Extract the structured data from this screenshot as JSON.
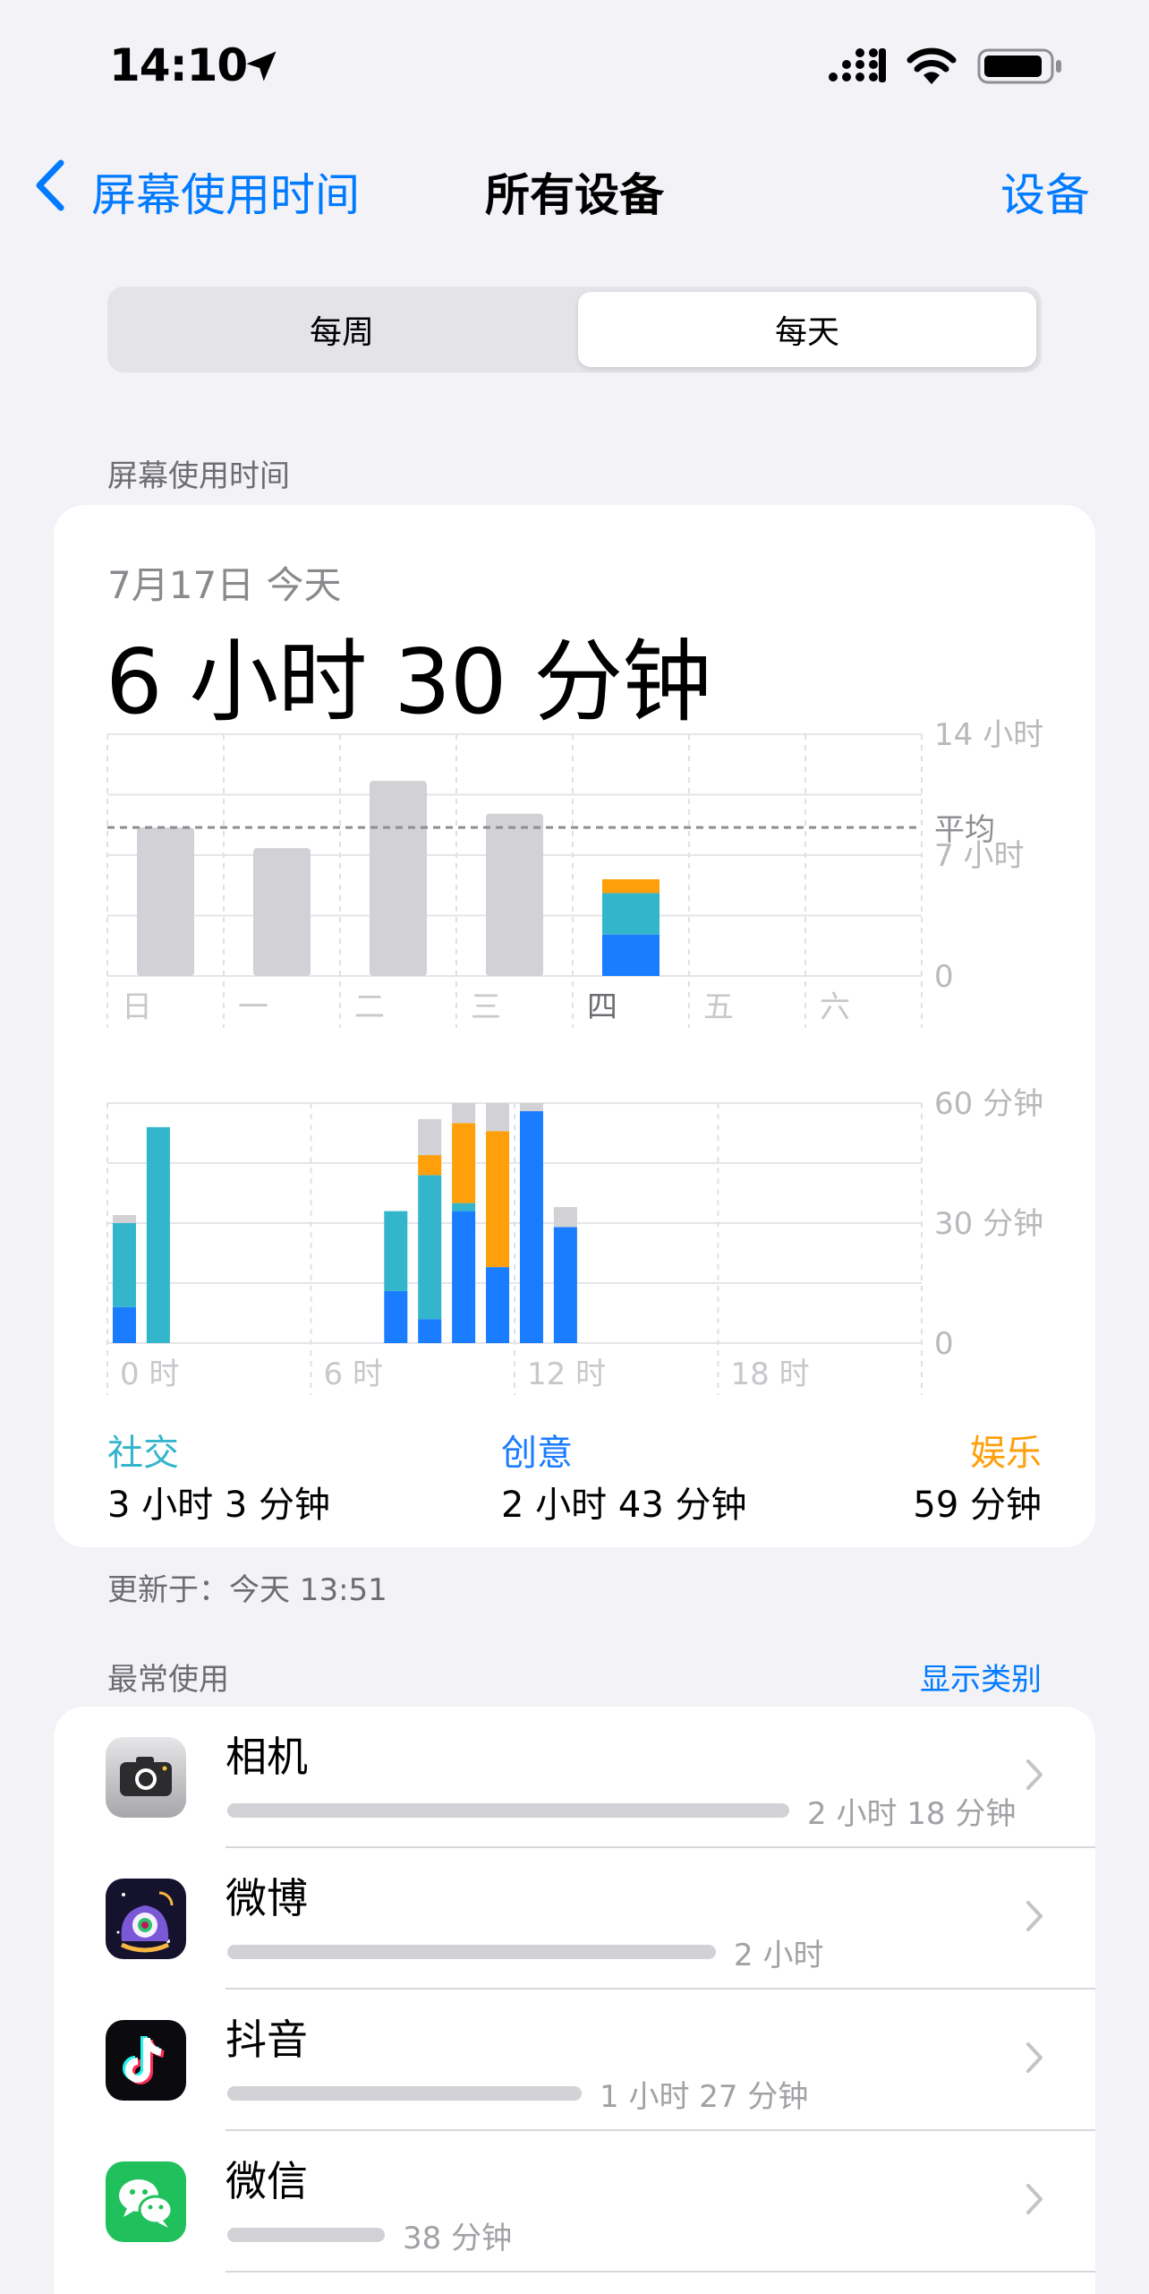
{
  "status_bar": {
    "time": "14:10"
  },
  "nav": {
    "back_label": "屏幕使用时间",
    "title": "所有设备",
    "right_label": "设备"
  },
  "segmented": {
    "weekly": "每周",
    "daily": "每天",
    "selected": "daily"
  },
  "section": {
    "screen_time_label": "屏幕使用时间",
    "most_used_label": "最常使用",
    "show_categories": "显示类别"
  },
  "summary": {
    "date": "7月17日 今天",
    "total": "6 小时 30 分钟",
    "updated": "更新于：今天 13:51"
  },
  "colors": {
    "social": "#33b5cc",
    "creativity": "#1a7cff",
    "entertainment": "#ff9f0a",
    "other": "#d1d1d6",
    "accent": "#007aff"
  },
  "chart_data": [
    {
      "type": "bar",
      "categories": [
        "日",
        "一",
        "二",
        "三",
        "四",
        "五",
        "六"
      ],
      "values": [
        8.6,
        7.4,
        11.3,
        9.4,
        5.6,
        0,
        0
      ],
      "series": [
        {
          "name": "社交",
          "values": [
            0,
            0,
            0,
            0,
            2.4
          ]
        },
        {
          "name": "创意",
          "values": [
            0,
            0,
            0,
            0,
            2.4
          ]
        },
        {
          "name": "娱乐",
          "values": [
            0,
            0,
            0,
            0,
            0.8
          ]
        }
      ],
      "ylim": [
        0,
        14
      ],
      "yticks": [
        {
          "value": 14,
          "label": "14 小时"
        },
        {
          "value": 7,
          "label": "7 小时"
        },
        {
          "value": 0,
          "label": "0"
        }
      ],
      "average": {
        "value": 8.6,
        "label": "平均"
      },
      "highlight_index": 4
    },
    {
      "type": "bar",
      "hours": [
        0,
        1,
        8,
        9,
        10,
        11,
        12,
        13
      ],
      "series": [
        {
          "name": "创意",
          "values": [
            9,
            0,
            13,
            6,
            33,
            19,
            58,
            29
          ]
        },
        {
          "name": "社交",
          "values": [
            21,
            54,
            20,
            36,
            2,
            0,
            0,
            0
          ]
        },
        {
          "name": "娱乐",
          "values": [
            0,
            0,
            0,
            5,
            20,
            34,
            0,
            0
          ]
        },
        {
          "name": "其他",
          "values": [
            2,
            0,
            0,
            9,
            5,
            7,
            2,
            5
          ]
        }
      ],
      "ylim": [
        0,
        60
      ],
      "yticks": [
        {
          "value": 60,
          "label": "60 分钟"
        },
        {
          "value": 30,
          "label": "30 分钟"
        },
        {
          "value": 0,
          "label": "0"
        }
      ],
      "xticks": [
        {
          "value": 0,
          "label": "0 时"
        },
        {
          "value": 6,
          "label": "6 时"
        },
        {
          "value": 12,
          "label": "12 时"
        },
        {
          "value": 18,
          "label": "18 时"
        }
      ]
    }
  ],
  "categories": [
    {
      "name": "社交",
      "time": "3 小时 3 分钟",
      "color": "#33b5cc"
    },
    {
      "name": "创意",
      "time": "2 小时 43 分钟",
      "color": "#1a7cff"
    },
    {
      "name": "娱乐",
      "time": "59 分钟",
      "color": "#ff9f0a"
    }
  ],
  "apps": [
    {
      "name": "相机",
      "time": "2 小时 18 分钟",
      "fraction": 1.0,
      "icon": "camera-icon"
    },
    {
      "name": "微博",
      "time": "2 小时",
      "fraction": 0.87,
      "icon": "weibo-icon"
    },
    {
      "name": "抖音",
      "time": "1 小时 27 分钟",
      "fraction": 0.63,
      "icon": "douyin-icon"
    },
    {
      "name": "微信",
      "time": "38 分钟",
      "fraction": 0.28,
      "icon": "wechat-icon"
    }
  ]
}
